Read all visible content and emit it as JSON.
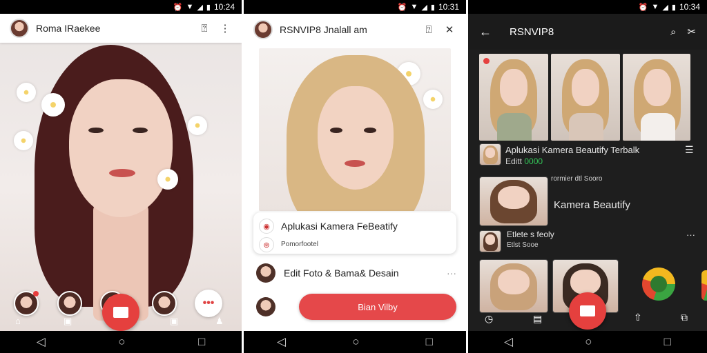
{
  "status": {
    "icons": [
      "alarm-icon",
      "wifi-icon",
      "signal-icon",
      "battery-icon"
    ],
    "phone1_time": "10:24",
    "phone2_time": "10:31",
    "phone3_time": "10:34"
  },
  "phone1": {
    "header": {
      "title": "Roma IRaekee"
    },
    "more_bubble": "•••"
  },
  "phone2": {
    "header": {
      "title": "RSNVIP8 Jnalall am"
    },
    "card": {
      "title": "Aplukasi Kamera FeBeatify",
      "subtitle": "Pomorfootel"
    },
    "row1": {
      "label": "Edit Foto & Bama& Desain",
      "more": "···"
    },
    "button": {
      "label": "Bian Vilby"
    }
  },
  "phone3": {
    "header": {
      "title": "RSNVIP8"
    },
    "item1": {
      "title": "Aplukasi Kamera Beautify Terbalk",
      "subtitle": "Editt",
      "rating": "0000"
    },
    "item2": {
      "caption": "rormier dtl Sooro",
      "title": "Kamera Beautify"
    },
    "item3": {
      "title": "Etlete s feoly",
      "subtitle": "Etlst Sooe",
      "more": "···"
    }
  },
  "colors": {
    "accent": "#e5403e",
    "dark_bg": "#1e1e1e",
    "green": "#34c759"
  }
}
